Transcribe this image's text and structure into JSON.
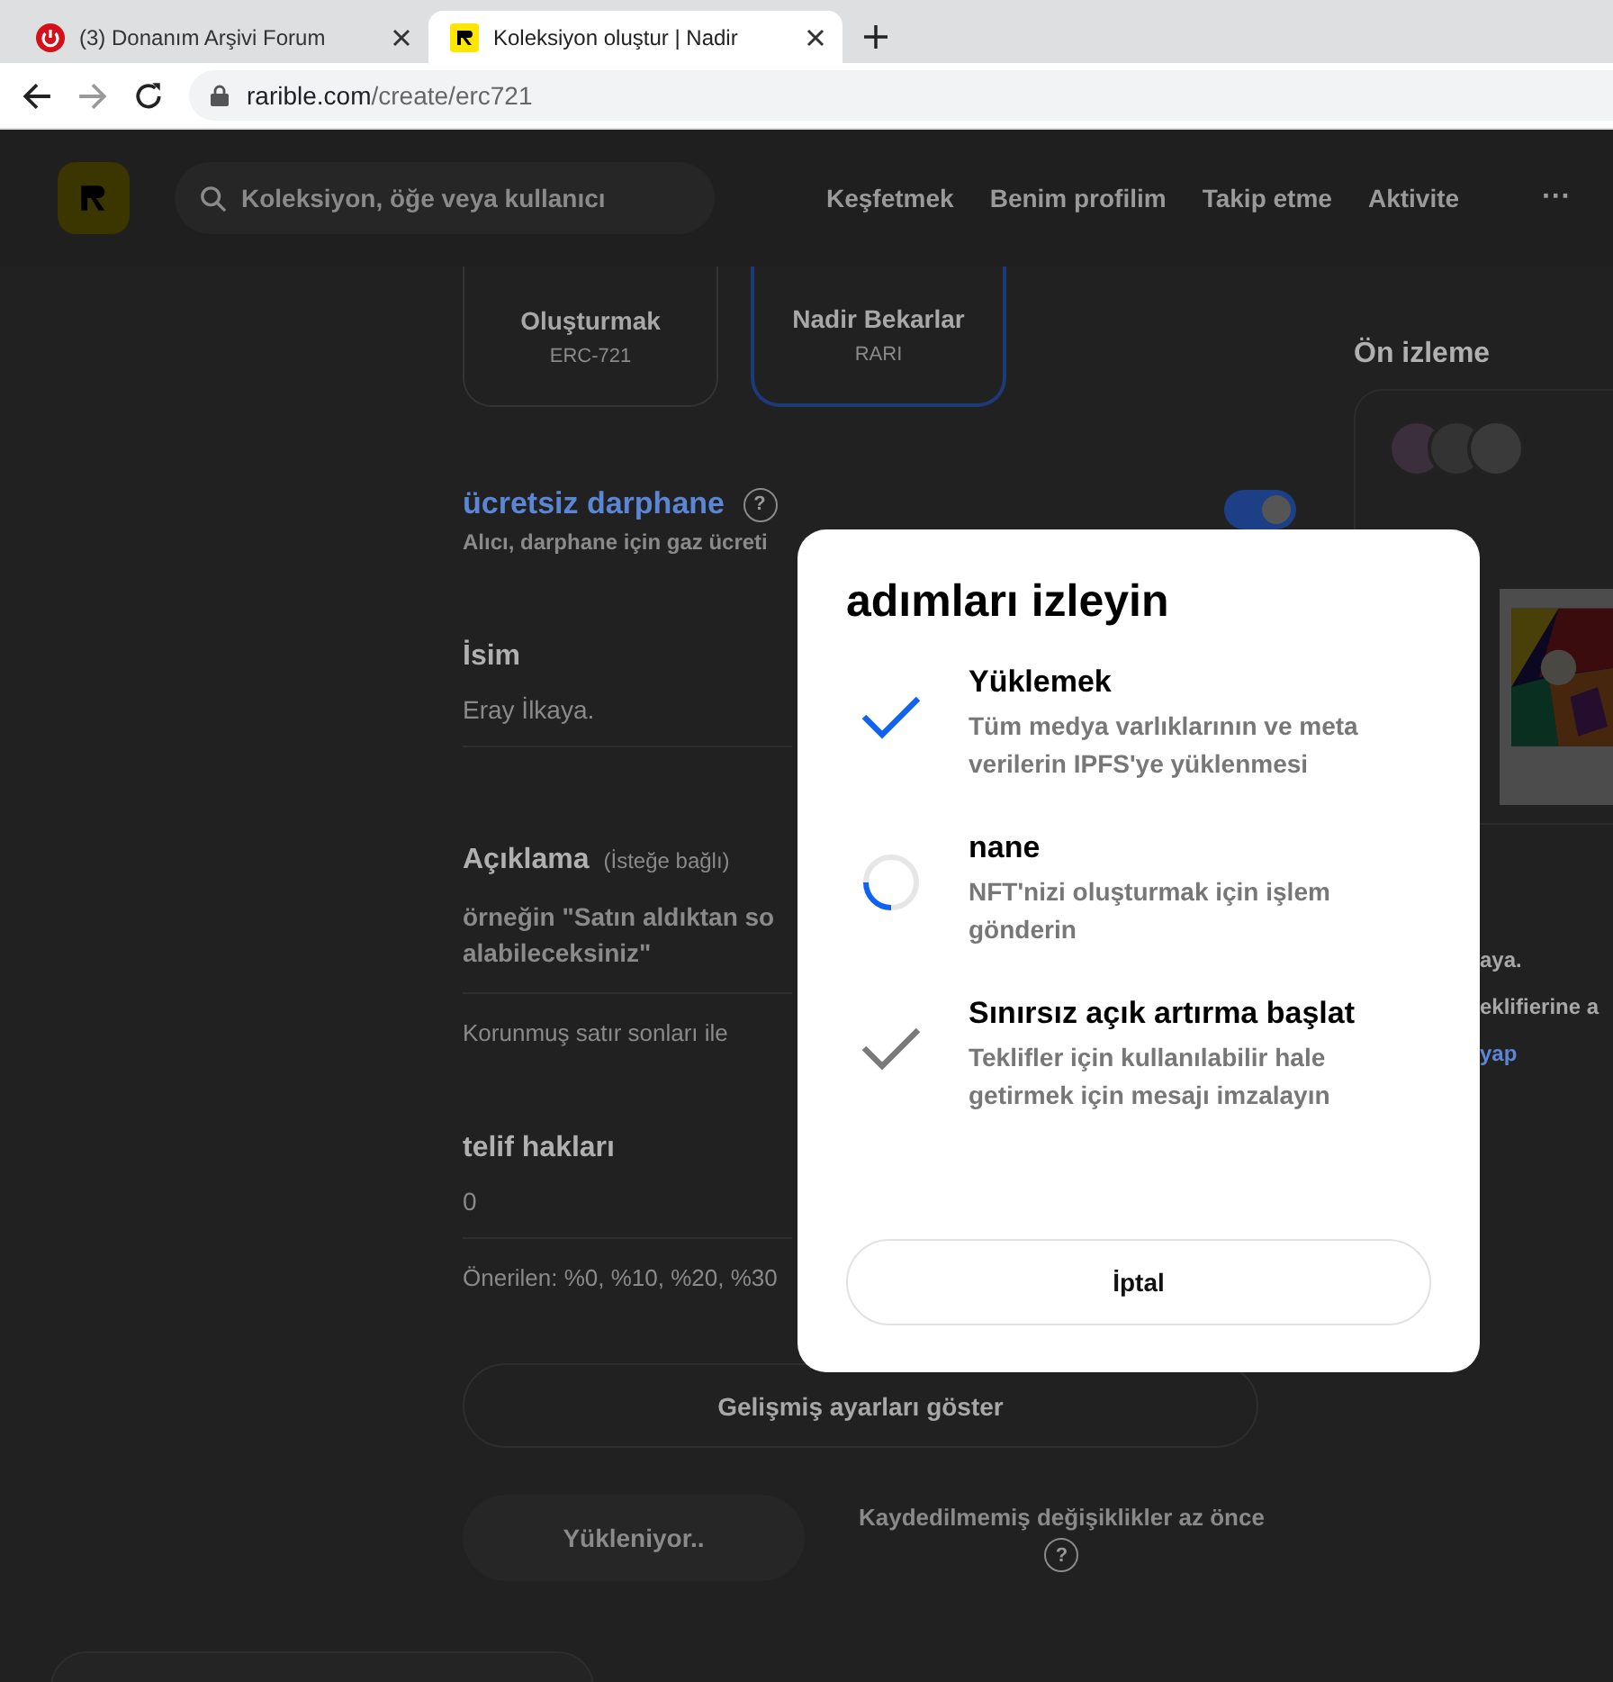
{
  "browser": {
    "tabs": [
      {
        "title": "(3) Donanım Arşivi Forum",
        "selected": false,
        "kind": "forum"
      },
      {
        "title": "Koleksiyon oluştur | Nadir",
        "selected": true,
        "kind": "rarible"
      }
    ],
    "address": {
      "host": "rarible.com",
      "path": "/create/erc721"
    }
  },
  "header": {
    "search_placeholder": "Koleksiyon, öğe veya kullanıcı",
    "nav": [
      "Keşfetmek",
      "Benim profilim",
      "Takip etme",
      "Aktivite"
    ],
    "more": "···"
  },
  "collection_types": [
    {
      "title": "Oluşturmak",
      "subtitle": "ERC-721",
      "selected": false
    },
    {
      "title": "Nadir Bekarlar",
      "subtitle": "RARI",
      "selected": true
    }
  ],
  "free_mint": {
    "title": "ücretsiz darphane",
    "description": "Alıcı, darphane için gaz ücreti",
    "on": true
  },
  "name": {
    "label": "İsim",
    "value": "Eray İlkaya."
  },
  "description": {
    "label": "Açıklama",
    "optional": "(İsteğe bağlı)",
    "placeholder": "örneğin \"Satın aldıktan so\nalabileceksiniz\"",
    "note": "Korunmuş satır sonları ile"
  },
  "royalties": {
    "label": "telif hakları",
    "value": "0",
    "note": "Önerilen: %0, %10, %20, %30"
  },
  "advanced_button": "Gelişmiş ayarları göster",
  "upload_button": "Yükleniyor..",
  "unsaved_note": "Kaydedilmemiş değişiklikler az önce",
  "help": "?",
  "preview": {
    "title": "Ön izleme",
    "texts": [
      "aya.",
      "eklifierine a"
    ],
    "link": "yap"
  },
  "modal": {
    "title": "adımları izleyin",
    "steps": [
      {
        "kind": "done",
        "title": "Yüklemek",
        "text": "Tüm medya varlıklarının ve meta verilerin IPFS'ye yüklenmesi"
      },
      {
        "kind": "loading",
        "title": "nane",
        "text": "NFT'nizi oluşturmak için işlem gönderin"
      },
      {
        "kind": "pending",
        "title": "Sınırsız açık artırma başlat",
        "text": "Teklifler için kullanılabilir hale getirmek için mesajı imzalayın"
      }
    ],
    "cancel": "İptal"
  }
}
